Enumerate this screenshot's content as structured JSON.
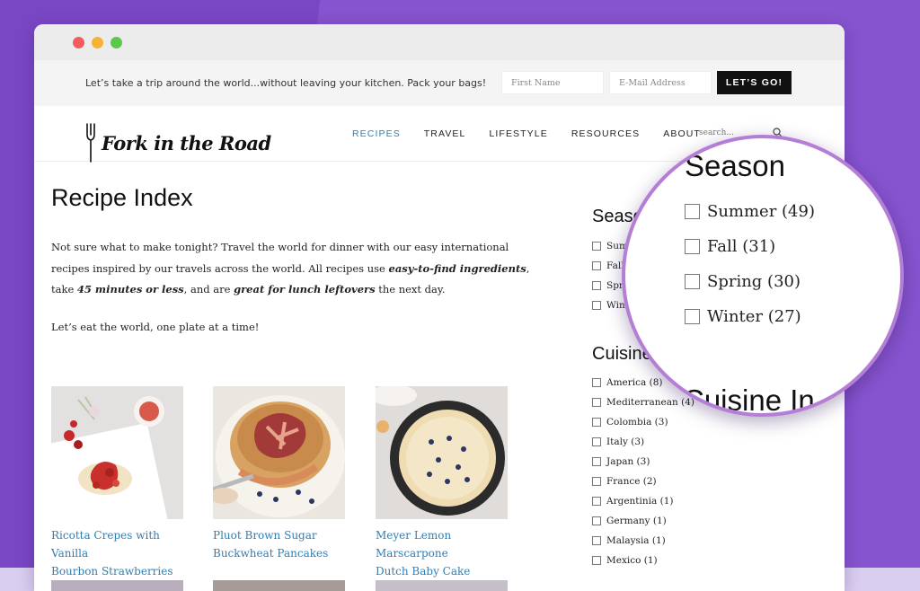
{
  "window": {
    "controls": [
      "close",
      "minimize",
      "maximize"
    ]
  },
  "promo": {
    "text": "Let’s take a trip around the world...without leaving your kitchen. Pack your bags!",
    "first_name_placeholder": "First Name",
    "email_placeholder": "E-Mail Address",
    "button_label": "LET’S GO!"
  },
  "header": {
    "logo_text": "Fork in the Road",
    "nav": [
      "RECIPES",
      "TRAVEL",
      "LIFESTYLE",
      "RESOURCES",
      "ABOUT"
    ],
    "active_nav": "RECIPES",
    "search_placeholder": "search..."
  },
  "main": {
    "title": "Recipe Index",
    "intro_part1": "Not sure what to make tonight? Travel the world for dinner with our easy international recipes inspired by our travels across the world. All recipes use ",
    "intro_bold1": "easy-to-find ingredients",
    "intro_part2": ", take ",
    "intro_bold2": "45 minutes or less",
    "intro_part3": ", and are ",
    "intro_bold3": "great for lunch leftovers",
    "intro_part4": " the next day.",
    "tagline": "Let’s eat the world, one plate at a time!"
  },
  "cards": [
    {
      "title_line1": "Ricotta Crepes with Vanilla",
      "title_line2": "Bourbon Strawberries"
    },
    {
      "title_line1": "Pluot Brown Sugar",
      "title_line2": "Buckwheat Pancakes"
    },
    {
      "title_line1": "Meyer Lemon Marscarpone",
      "title_line2": "Dutch Baby Cake"
    }
  ],
  "sidebar": {
    "season_heading": "Season",
    "season_items": [
      {
        "label": "Summer (49)"
      },
      {
        "label": "Fall (31)"
      },
      {
        "label": "Spring (30)"
      },
      {
        "label": "Winter (27)"
      }
    ],
    "cuisine_heading": "Cuisine Index",
    "cuisine_items": [
      {
        "label": "America (8)"
      },
      {
        "label": "Mediterranean (4)"
      },
      {
        "label": "Colombia (3)"
      },
      {
        "label": "Italy (3)"
      },
      {
        "label": "Japan (3)"
      },
      {
        "label": "France (2)"
      },
      {
        "label": "Argentinia (1)"
      },
      {
        "label": "Germany (1)"
      },
      {
        "label": "Malaysia (1)"
      },
      {
        "label": "Mexico (1)"
      }
    ]
  },
  "magnifier": {
    "heading": "Season",
    "heading2": "Cuisine In"
  }
}
